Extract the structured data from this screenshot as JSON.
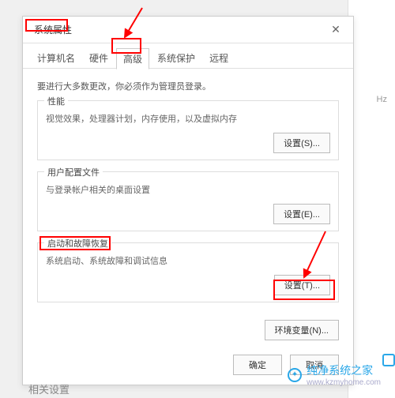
{
  "backdrop": {
    "hz": "Hz"
  },
  "dialog": {
    "title": "系统属性",
    "close": "✕",
    "tabs": {
      "computer_name": "计算机名",
      "hardware": "硬件",
      "advanced": "高级",
      "protection": "系统保护",
      "remote": "远程"
    },
    "intro": "要进行大多数更改，你必须作为管理员登录。",
    "groups": {
      "perf": {
        "label": "性能",
        "desc": "视觉效果，处理器计划，内存使用，以及虚拟内存",
        "btn": "设置(S)..."
      },
      "profile": {
        "label": "用户配置文件",
        "desc": "与登录帐户相关的桌面设置",
        "btn": "设置(E)..."
      },
      "startup": {
        "label": "启动和故障恢复",
        "desc": "系统启动、系统故障和调试信息",
        "btn": "设置(T)..."
      }
    },
    "env_btn": "环境变量(N)...",
    "footer": {
      "ok": "确定",
      "cancel": "取消"
    }
  },
  "watermark": {
    "brand": "纯净系统之家",
    "url": "www.kzmyhome.com"
  },
  "bg_text": "相关设置"
}
